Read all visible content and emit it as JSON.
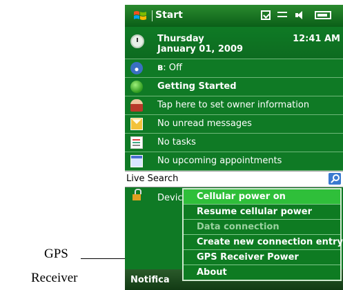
{
  "titlebar": {
    "app_title": "Start"
  },
  "date": {
    "day": "Thursday",
    "date": "January 01, 2009",
    "time": "12:41 AM"
  },
  "bluetooth": {
    "status": ": Off"
  },
  "today_items": {
    "getting_started": "Getting Started",
    "owner": "Tap here to set owner information",
    "messages": "No unread messages",
    "tasks": "No tasks",
    "appointments": "No upcoming appointments"
  },
  "search": {
    "label": "Live Search"
  },
  "device": {
    "label": "Device"
  },
  "softkeys": {
    "left": "Notifica"
  },
  "menu": {
    "items": [
      {
        "label": "Cellular power on",
        "state": "selected"
      },
      {
        "label": "Resume cellular power",
        "state": "enabled"
      },
      {
        "label": "Data connection",
        "state": "disabled"
      },
      {
        "label": "Create new connection entry",
        "state": "enabled"
      },
      {
        "label": "GPS Receiver Power",
        "state": "enabled"
      },
      {
        "label": "About",
        "state": "enabled"
      }
    ]
  },
  "annotation": {
    "line1": "GPS",
    "line2": "Receiver"
  },
  "colors": {
    "screen_bg": "#0f7a25",
    "menu_selected": "#2fbf3a",
    "titlebar": "#0b5f18"
  },
  "icons": [
    "windows-logo",
    "clock-icon",
    "wifi-icon",
    "bluetooth-icon",
    "getting-started-icon",
    "owner-icon",
    "mail-icon",
    "tasks-icon",
    "calendar-icon",
    "search-icon",
    "lock-icon"
  ]
}
